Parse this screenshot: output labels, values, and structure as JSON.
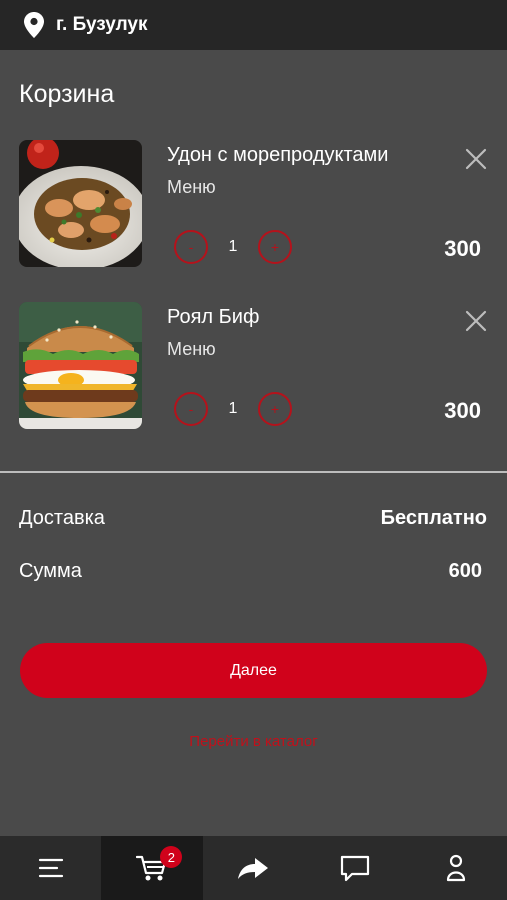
{
  "header": {
    "city": "г. Бузулук",
    "location_icon": "map-pin-icon"
  },
  "page": {
    "title": "Корзина"
  },
  "cart": {
    "items": [
      {
        "name": "Удон с морепродуктами",
        "category": "Меню",
        "quantity": "1",
        "price": "300",
        "decrease_symbol": "-",
        "increase_symbol": "+",
        "image": "udon-dish-photo"
      },
      {
        "name": "Роял Биф",
        "category": "Меню",
        "quantity": "1",
        "price": "300",
        "decrease_symbol": "-",
        "increase_symbol": "+",
        "image": "burger-photo"
      }
    ]
  },
  "summary": {
    "delivery_label": "Доставка",
    "delivery_value": "Бесплатно",
    "total_label": "Сумма",
    "total_value": "600"
  },
  "actions": {
    "next_label": "Далее",
    "catalog_link": "Перейти в каталог"
  },
  "tabbar": {
    "tabs": [
      {
        "icon": "menu-icon"
      },
      {
        "icon": "cart-icon",
        "badge": "2",
        "active": true
      },
      {
        "icon": "share-icon"
      },
      {
        "icon": "chat-icon"
      },
      {
        "icon": "profile-icon"
      }
    ]
  },
  "colors": {
    "accent": "#d0021b",
    "background": "#4a4a4a",
    "topbar": "#262626",
    "tabbar": "#2b2b2b"
  }
}
